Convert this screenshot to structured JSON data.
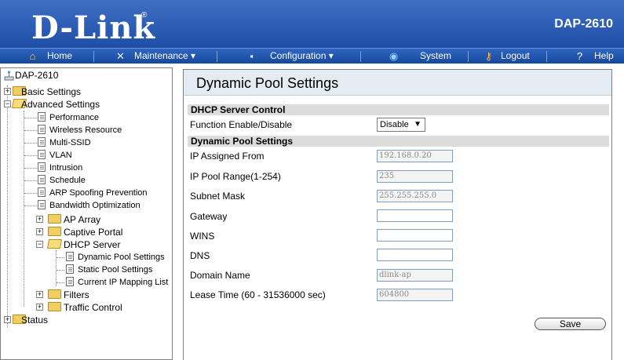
{
  "header": {
    "logo": "D-Link",
    "model": "DAP-2610"
  },
  "menu": [
    {
      "label": "Home",
      "icon": "home-icon"
    },
    {
      "label": "Maintenance ▾",
      "icon": "tools-icon"
    },
    {
      "label": "Configuration ▾",
      "icon": "disk-icon"
    },
    {
      "label": "System",
      "icon": "system-icon"
    },
    {
      "label": "Logout",
      "icon": "logout-icon"
    },
    {
      "label": "Help",
      "icon": "help-icon"
    }
  ],
  "tree": {
    "root": "DAP-2610",
    "basic": "Basic Settings",
    "advanced": "Advanced Settings",
    "items": [
      "Performance",
      "Wireless Resource",
      "Multi-SSID",
      "VLAN",
      "Intrusion",
      "Schedule",
      "ARP Spoofing Prevention",
      "Bandwidth Optimization"
    ],
    "ap_array": "AP Array",
    "captive_portal": "Captive Portal",
    "dhcp_server": "DHCP Server",
    "dhcp_items": [
      "Dynamic Pool Settings",
      "Static Pool Settings",
      "Current IP Mapping List"
    ],
    "filters": "Filters",
    "traffic_control": "Traffic Control",
    "status": "Status"
  },
  "main": {
    "title": "Dynamic Pool Settings",
    "section1": "DHCP Server Control",
    "function_label": "Function Enable/Disable",
    "function_value": "Disable",
    "section2": "Dynamic Pool Settings",
    "fields": [
      {
        "label": "IP Assigned From",
        "value": "192.168.0.20"
      },
      {
        "label": "IP Pool Range(1-254)",
        "value": "235"
      },
      {
        "label": "Subnet Mask",
        "value": "255.255.255.0"
      },
      {
        "label": "Gateway",
        "value": ""
      },
      {
        "label": "WINS",
        "value": ""
      },
      {
        "label": "DNS",
        "value": ""
      },
      {
        "label": "Domain Name",
        "value": "dlink-ap"
      },
      {
        "label": "Lease Time (60 - 31536000 sec)",
        "value": "604800"
      }
    ],
    "save_label": "Save"
  }
}
